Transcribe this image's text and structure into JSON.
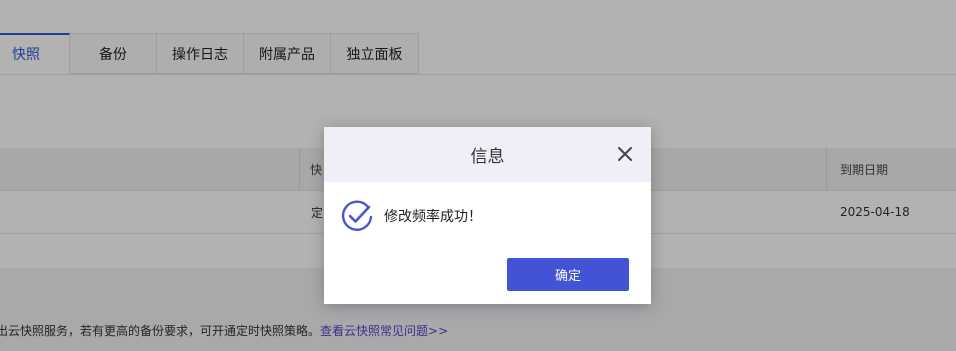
{
  "tabs": [
    {
      "label": "快照",
      "active": true
    },
    {
      "label": "备份"
    },
    {
      "label": "操作日志"
    },
    {
      "label": "附属产品"
    },
    {
      "label": "独立面板"
    }
  ],
  "table": {
    "headers": [
      "快",
      "到期日期"
    ],
    "row": [
      "定",
      "2025-04-18"
    ]
  },
  "notice": {
    "text": "出云快照服务，若有更高的备份要求，可开通定时快照策略。",
    "link": "查看云快照常见问题>>"
  },
  "modal": {
    "title": "信息",
    "message": "修改频率成功！",
    "ok_label": "确定",
    "icon": "success-check-icon",
    "accent_color": "#4253d6"
  },
  "colors": {
    "active_tab": "#2f5bd3",
    "link": "#5b3fbf"
  }
}
